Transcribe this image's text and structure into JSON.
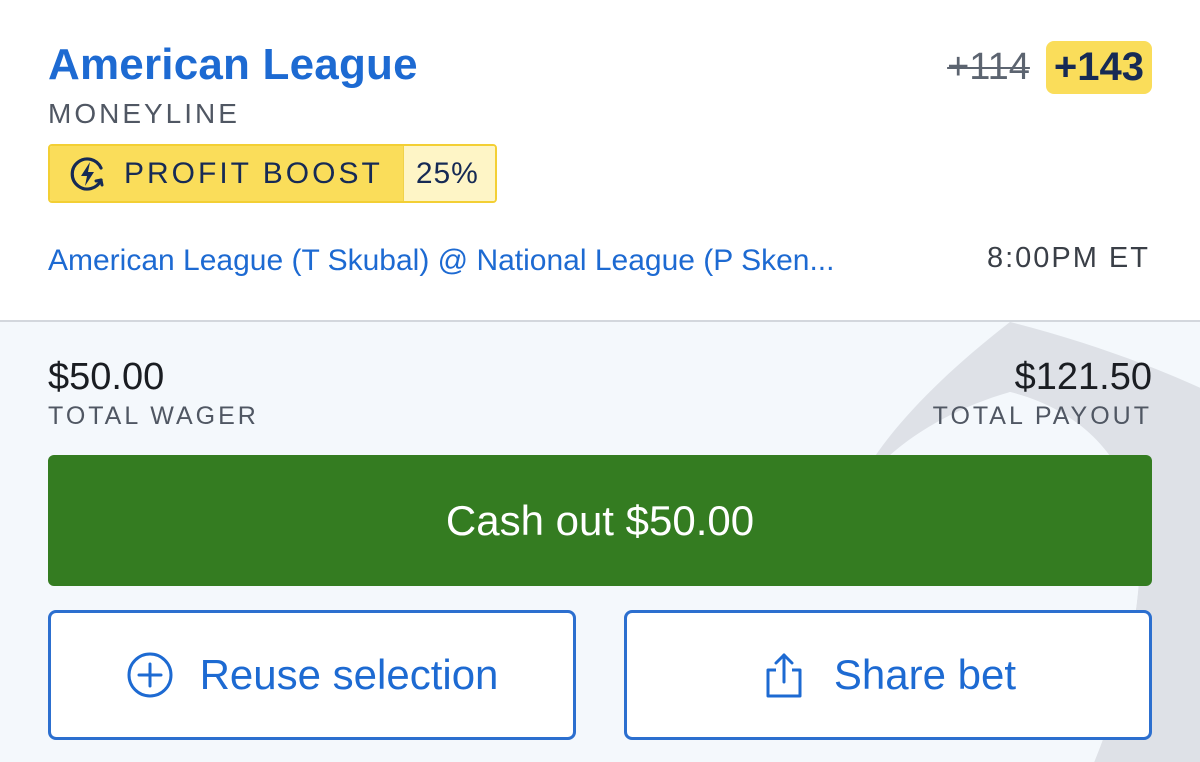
{
  "selection": {
    "name": "American League",
    "market": "MONEYLINE"
  },
  "odds": {
    "original": "+114",
    "boosted": "+143"
  },
  "boost": {
    "icon": "bolt-refresh-icon",
    "label": "PROFIT BOOST",
    "percent": "25%"
  },
  "event": {
    "matchup": "American League (T Skubal) @ National League (P Sken...",
    "time": "8:00PM ET"
  },
  "wager": {
    "amount": "$50.00",
    "label": "TOTAL WAGER"
  },
  "payout": {
    "amount": "$121.50",
    "label": "TOTAL PAYOUT"
  },
  "actions": {
    "cashout_label": "Cash out $50.00",
    "reuse_label": "Reuse selection",
    "reuse_icon": "plus-circle-icon",
    "share_label": "Share bet",
    "share_icon": "share-icon"
  },
  "colors": {
    "accent_blue": "#1d6ad2",
    "boost_yellow": "#fadd5a",
    "cashout_green": "#347c21",
    "text_dark": "#162a55"
  }
}
